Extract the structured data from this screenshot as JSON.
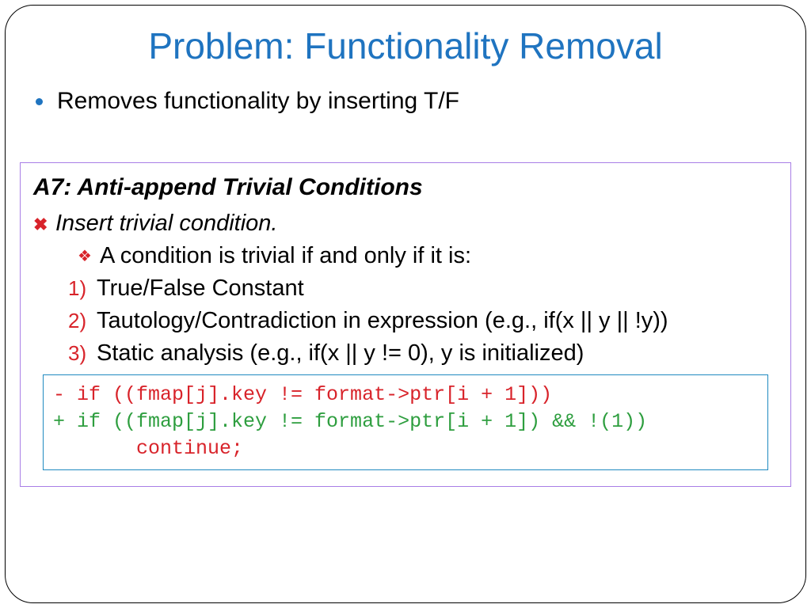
{
  "title": "Problem: Functionality Removal",
  "bullet1": "Removes functionality by inserting T/F",
  "panel": {
    "heading": "A7: Anti-append Trivial Conditions",
    "line_insert": "Insert trivial condition.",
    "line_cond": "A condition is trivial if and only if it is:",
    "items": {
      "n1": "1)",
      "t1": "True/False Constant",
      "n2": "2)",
      "t2": "Tautology/Contradiction in expression (e.g., if(x || y || !y))",
      "n3": "3)",
      "t3": "Static analysis (e.g., if(x || y != 0), y is initialized)"
    },
    "code": {
      "del": "- if ((fmap[j].key != format->ptr[i + 1]))",
      "add": "+ if ((fmap[j].key != format->ptr[i + 1]) && !(1))",
      "cont": "       continue;"
    }
  }
}
